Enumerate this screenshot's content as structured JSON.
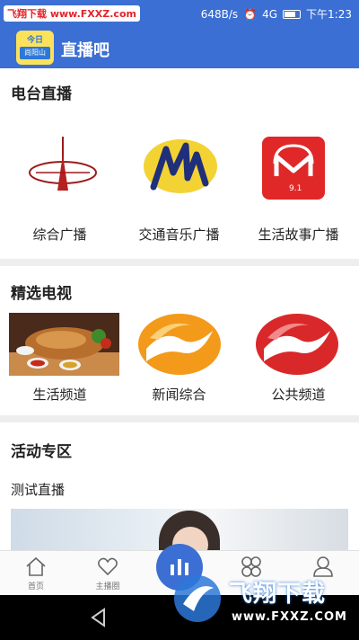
{
  "status_bar": {
    "watermark": "飞翔下载 www.FXXZ.com",
    "net_speed": "648B/s",
    "signal": "4G",
    "time": "下午1:23"
  },
  "app_bar": {
    "logo_text_top": "今日",
    "logo_text_bottom": "尚阳山",
    "title": "直播吧"
  },
  "radio": {
    "title": "电台直播",
    "items": [
      {
        "label": "综合广播",
        "icon": "radio-tower-logo"
      },
      {
        "label": "交通音乐广播",
        "icon": "traffic-music-logo"
      },
      {
        "label": "生活故事广播",
        "icon": "life-story-logo"
      }
    ]
  },
  "tv": {
    "title": "精选电视",
    "items": [
      {
        "label": "生活频道",
        "icon": "food-photo"
      },
      {
        "label": "新闻综合",
        "icon": "orange-swoosh-logo"
      },
      {
        "label": "公共频道",
        "icon": "red-swoosh-logo"
      }
    ]
  },
  "events": {
    "title": "活动专区",
    "subtitle": "测试直播"
  },
  "bottom_nav": {
    "items": [
      {
        "label": "首页",
        "icon": "home-icon"
      },
      {
        "label": "主播圈",
        "icon": "anchor-circle-icon"
      },
      {
        "label": "",
        "icon": "live-icon"
      },
      {
        "label": "",
        "icon": "apps-icon"
      },
      {
        "label": "",
        "icon": "user-icon"
      }
    ]
  },
  "watermark_bottom": {
    "title": "飞翔下载",
    "url": "www.FXXZ.COM"
  },
  "colors": {
    "primary": "#3b6fd3",
    "divider": "#eeeeee"
  }
}
